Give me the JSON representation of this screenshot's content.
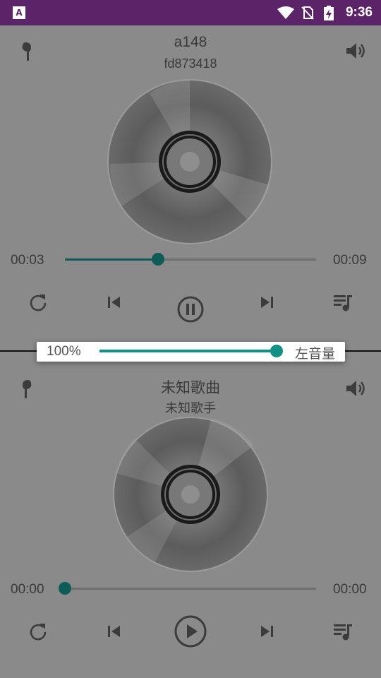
{
  "statusbar": {
    "app_icon_letter": "A",
    "time": "9:36",
    "icons": [
      "wifi-icon",
      "no-sim-icon",
      "battery-charging-icon"
    ]
  },
  "player_top": {
    "title": "a148",
    "artist": "fd873418",
    "elapsed": "00:03",
    "duration": "00:09",
    "progress_fraction": 0.37,
    "state": "playing",
    "icons": [
      "earphone-icon",
      "volume-icon",
      "repeat-icon",
      "previous-icon",
      "pause-icon",
      "next-icon",
      "playlist-icon"
    ]
  },
  "player_bottom": {
    "title": "未知歌曲",
    "artist": "未知歌手",
    "elapsed": "00:00",
    "duration": "00:00",
    "progress_fraction": 0.0,
    "state": "paused",
    "icons": [
      "earphone-icon",
      "volume-icon",
      "repeat-icon",
      "previous-icon",
      "play-icon",
      "next-icon",
      "playlist-icon"
    ]
  },
  "volume_popup": {
    "percent_label": "100%",
    "level_fraction": 1.0,
    "channel_label": "左音量"
  },
  "colors": {
    "statusbar": "#5b2368",
    "accent": "#0d5c58",
    "popup_accent": "#109186",
    "panel": "#8a8a8a"
  }
}
